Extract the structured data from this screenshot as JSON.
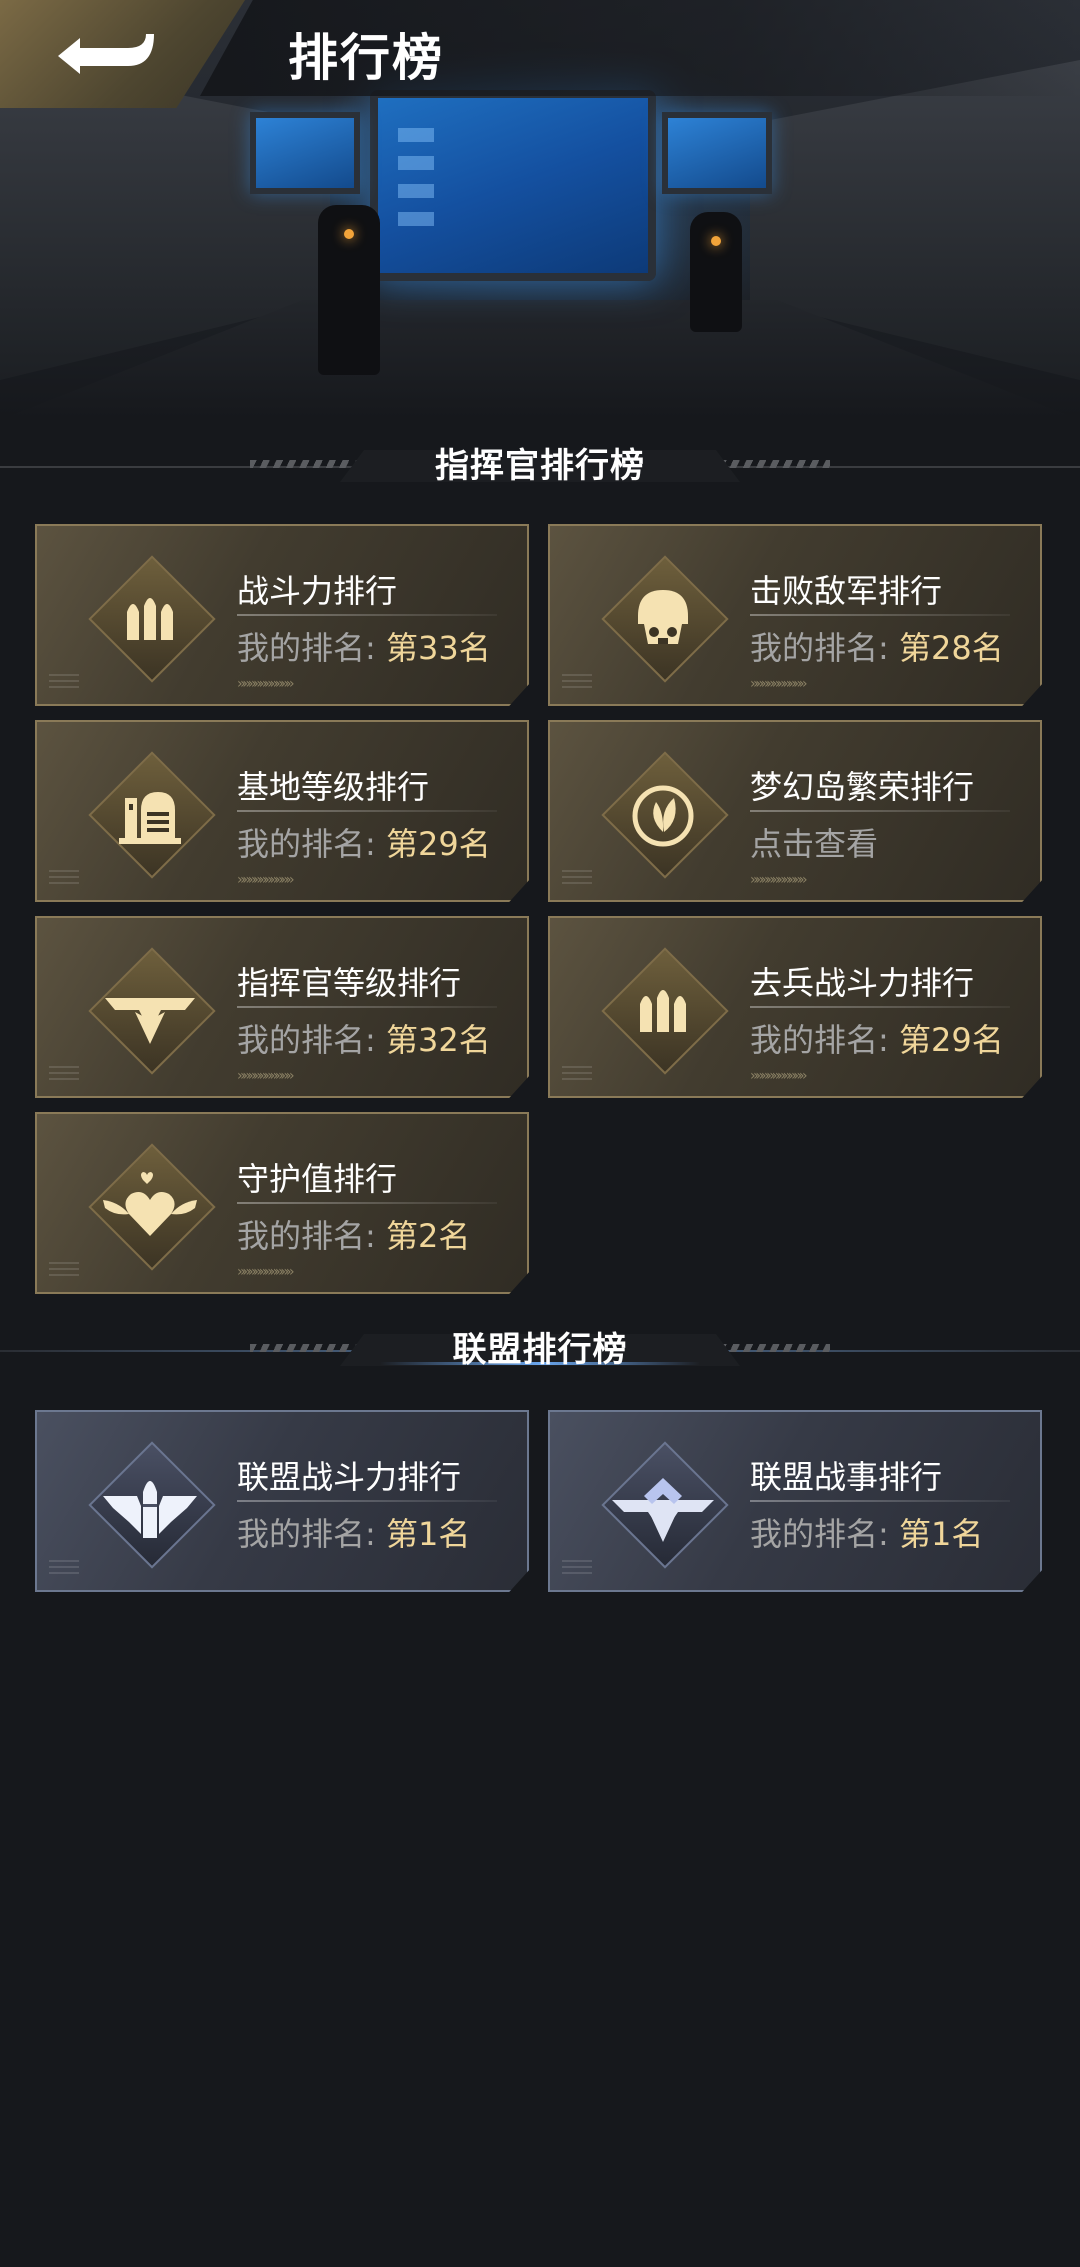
{
  "header": {
    "title": "排行榜"
  },
  "commander_section": {
    "title": "指挥官排行榜",
    "cards": [
      {
        "name": "战斗力排行",
        "rank_prefix": "我的排名: ",
        "rank_value": "第33名",
        "icon": "bullets-icon"
      },
      {
        "name": "击败敌军排行",
        "rank_prefix": "我的排名: ",
        "rank_value": "第28名",
        "icon": "soldier-helmet-icon"
      },
      {
        "name": "基地等级排行",
        "rank_prefix": "我的排名: ",
        "rank_value": "第29名",
        "icon": "base-building-icon"
      },
      {
        "name": "梦幻岛繁荣排行",
        "rank_prefix": "点击查看",
        "rank_value": "",
        "icon": "leaf-icon"
      },
      {
        "name": "指挥官等级排行",
        "rank_prefix": "我的排名: ",
        "rank_value": "第32名",
        "icon": "winged-chevron-icon"
      },
      {
        "name": "去兵战斗力排行",
        "rank_prefix": "我的排名: ",
        "rank_value": "第29名",
        "icon": "bullets-icon"
      },
      {
        "name": "守护值排行",
        "rank_prefix": "我的排名: ",
        "rank_value": "第2名",
        "icon": "winged-heart-icon"
      }
    ]
  },
  "alliance_section": {
    "title": "联盟排行榜",
    "cards": [
      {
        "name": "联盟战斗力排行",
        "rank_prefix": "我的排名: ",
        "rank_value": "第1名",
        "icon": "winged-bullet-icon"
      },
      {
        "name": "联盟战事排行",
        "rank_prefix": "我的排名: ",
        "rank_value": "第1名",
        "icon": "winged-shield-icon"
      }
    ]
  },
  "colors": {
    "gold_accent": "#f0d69a",
    "gold_border": "#8a7a58",
    "blue_border": "#6c7890",
    "background": "#16181c"
  }
}
